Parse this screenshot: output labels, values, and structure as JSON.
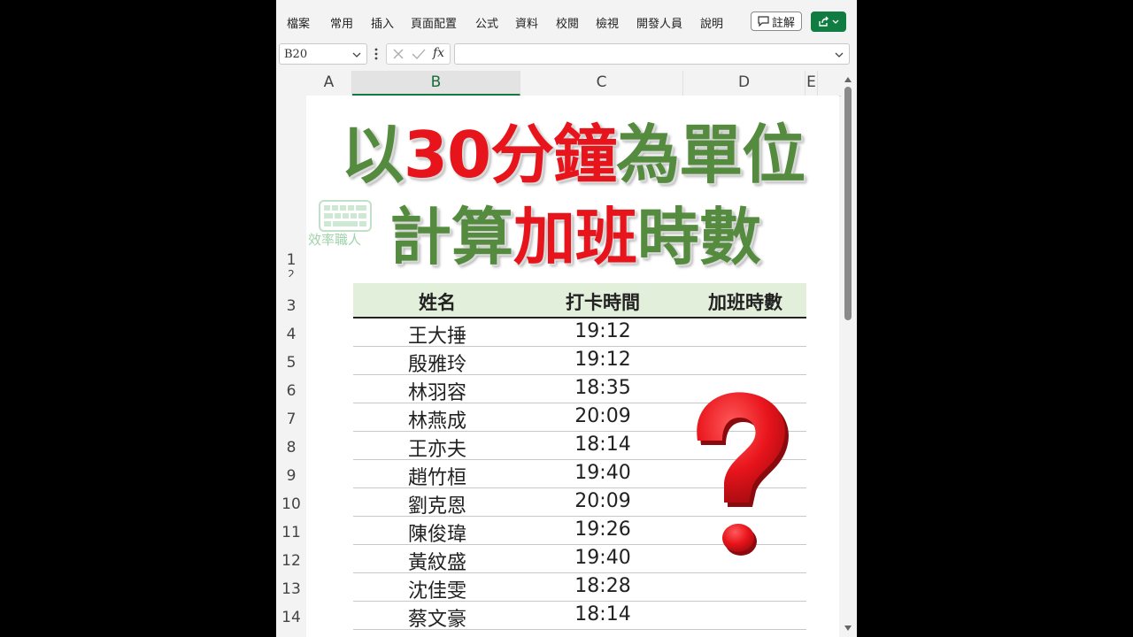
{
  "ribbon": {
    "menu": [
      "檔案",
      "常用",
      "插入",
      "頁面配置",
      "公式",
      "資料",
      "校閱",
      "檢視",
      "開發人員",
      "說明"
    ],
    "comment_label": "註解"
  },
  "formula_bar": {
    "name_box": "B20",
    "formula": ""
  },
  "columns": [
    "A",
    "B",
    "C",
    "D",
    "E"
  ],
  "rows": [
    "1",
    "2",
    "3",
    "4",
    "5",
    "6",
    "7",
    "8",
    "9",
    "10",
    "11",
    "12",
    "13",
    "14"
  ],
  "title": {
    "line1": [
      "以",
      "30分",
      "鐘",
      "為單位"
    ],
    "line2": [
      "計算",
      "加班",
      "時數"
    ]
  },
  "watermark_text": "效率職人",
  "table": {
    "headers": [
      "姓名",
      "打卡時間",
      "加班時數"
    ],
    "rows": [
      [
        "王大捶",
        "19:12"
      ],
      [
        "殷雅玲",
        "19:12"
      ],
      [
        "林羽容",
        "18:35"
      ],
      [
        "林燕成",
        "20:09"
      ],
      [
        "王亦夫",
        "18:14"
      ],
      [
        "趙竹桓",
        "19:40"
      ],
      [
        "劉克恩",
        "20:09"
      ],
      [
        "陳俊瑋",
        "19:26"
      ],
      [
        "黃紋盛",
        "19:40"
      ],
      [
        "沈佳雯",
        "18:28"
      ],
      [
        "蔡文豪",
        "18:14"
      ]
    ]
  },
  "overlay_symbol": "?",
  "colors": {
    "accent_green": "#107c41",
    "title_green": "#558b3f",
    "title_red": "#e8141b",
    "header_fill": "#e2efda",
    "question_red": "#e8141b"
  }
}
